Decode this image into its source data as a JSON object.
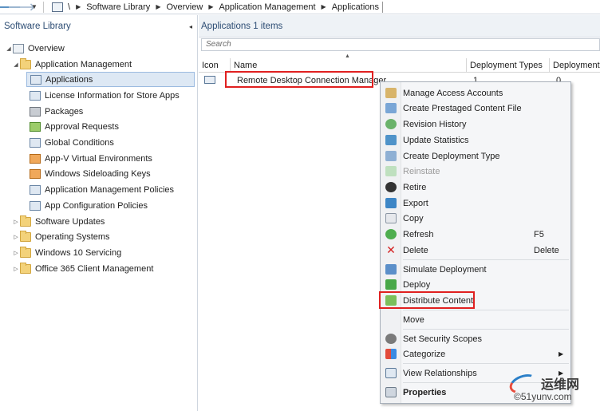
{
  "breadcrumb": {
    "root_label": "\\",
    "items": [
      "Software Library",
      "Overview",
      "Application Management",
      "Applications"
    ]
  },
  "nav": {
    "title": "Software Library",
    "collapse_glyph": "◂",
    "tree": [
      {
        "label": "Overview",
        "icon": "overview-icon"
      },
      {
        "label": "Application Management",
        "icon": "folder-icon"
      },
      {
        "label": "Applications",
        "icon": "applications-icon",
        "selected": true
      },
      {
        "label": "License Information for Store Apps",
        "icon": "license-icon"
      },
      {
        "label": "Packages",
        "icon": "packages-icon"
      },
      {
        "label": "Approval Requests",
        "icon": "approval-icon"
      },
      {
        "label": "Global Conditions",
        "icon": "global-conditions-icon"
      },
      {
        "label": "App-V Virtual Environments",
        "icon": "appv-icon"
      },
      {
        "label": "Windows Sideloading Keys",
        "icon": "keys-icon"
      },
      {
        "label": "Application Management Policies",
        "icon": "policies-icon"
      },
      {
        "label": "App Configuration Policies",
        "icon": "config-policies-icon"
      },
      {
        "label": "Software Updates",
        "icon": "folder-icon"
      },
      {
        "label": "Operating Systems",
        "icon": "folder-icon"
      },
      {
        "label": "Windows 10 Servicing",
        "icon": "folder-icon"
      },
      {
        "label": "Office 365 Client Management",
        "icon": "folder-icon"
      }
    ]
  },
  "main": {
    "title": "Applications 1 items",
    "search_placeholder": "Search",
    "columns": [
      "Icon",
      "Name",
      "Deployment Types",
      "Deployment"
    ],
    "rows": [
      {
        "name": "Remote Desktop Connection Manager",
        "deployment_types": "1",
        "deployments": "0"
      }
    ]
  },
  "context_menu": {
    "items": [
      {
        "label": "Manage Access Accounts",
        "icon": "access-accounts-icon"
      },
      {
        "label": "Create Prestaged Content File",
        "icon": "prestaged-content-icon"
      },
      {
        "label": "Revision History",
        "icon": "revision-history-icon"
      },
      {
        "label": "Update Statistics",
        "icon": "update-statistics-icon"
      },
      {
        "label": "Create Deployment Type",
        "icon": "deployment-type-icon"
      },
      {
        "label": "Reinstate",
        "icon": "reinstate-icon",
        "disabled": true
      },
      {
        "label": "Retire",
        "icon": "retire-icon"
      },
      {
        "label": "Export",
        "icon": "export-icon"
      },
      {
        "label": "Copy",
        "icon": "copy-icon"
      },
      {
        "label": "Refresh",
        "icon": "refresh-icon",
        "shortcut": "F5"
      },
      {
        "label": "Delete",
        "icon": "delete-icon",
        "shortcut": "Delete"
      },
      {
        "label": "Simulate Deployment",
        "icon": "simulate-icon"
      },
      {
        "label": "Deploy",
        "icon": "deploy-icon"
      },
      {
        "label": "Distribute Content",
        "icon": "distribute-icon"
      },
      {
        "label": "Move",
        "icon": "move-icon"
      },
      {
        "label": "Set Security Scopes",
        "icon": "security-scopes-icon"
      },
      {
        "label": "Categorize",
        "icon": "categorize-icon",
        "submenu": true
      },
      {
        "label": "View Relationships",
        "icon": "relationships-icon",
        "submenu": true
      },
      {
        "label": "Properties",
        "icon": "properties-icon",
        "bold": true
      }
    ]
  },
  "watermark": {
    "line1": "运维网",
    "line2": "©51yunv.com"
  },
  "colors": {
    "highlight_border": "#e02020",
    "selection_bg": "#dde8f4",
    "title_blue": "#2d4d74"
  }
}
